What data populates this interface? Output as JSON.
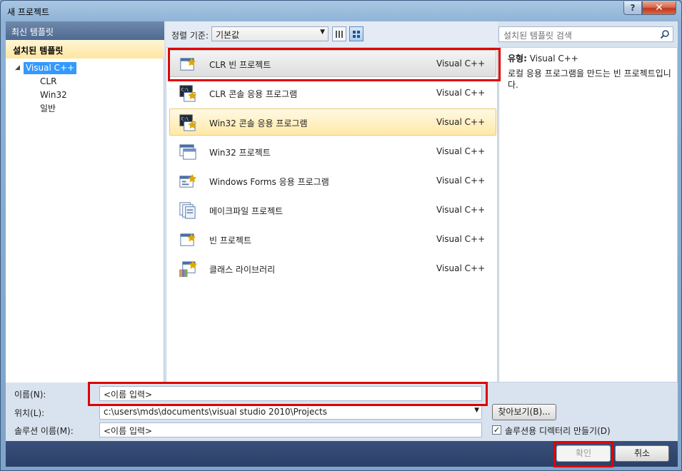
{
  "window": {
    "title": "새 프로젝트",
    "help_glyph": "?",
    "close_glyph": "✕"
  },
  "sidebar": {
    "recent_label": "최신 템플릿",
    "installed_label": "설치된 템플릿",
    "tree": {
      "root": "Visual C++",
      "children": [
        "CLR",
        "Win32",
        "일반"
      ]
    }
  },
  "toolbar": {
    "sort_label": "정렬 기준:",
    "sort_value": "기본값"
  },
  "search": {
    "placeholder": "설치된 템플릿 검색"
  },
  "templates": [
    {
      "name": "CLR 빈 프로젝트",
      "lang": "Visual C++",
      "icon": "empty-project-icon",
      "state": "selected"
    },
    {
      "name": "CLR 콘솔 응용 프로그램",
      "lang": "Visual C++",
      "icon": "console-app-icon",
      "state": ""
    },
    {
      "name": "Win32 콘솔 응용 프로그램",
      "lang": "Visual C++",
      "icon": "console-app-icon",
      "state": "hover"
    },
    {
      "name": "Win32 프로젝트",
      "lang": "Visual C++",
      "icon": "window-project-icon",
      "state": ""
    },
    {
      "name": "Windows Forms 응용 프로그램",
      "lang": "Visual C++",
      "icon": "forms-app-icon",
      "state": ""
    },
    {
      "name": "메이크파일 프로젝트",
      "lang": "Visual C++",
      "icon": "makefile-icon",
      "state": ""
    },
    {
      "name": "빈 프로젝트",
      "lang": "Visual C++",
      "icon": "empty-project-icon",
      "state": ""
    },
    {
      "name": "클래스 라이브러리",
      "lang": "Visual C++",
      "icon": "class-library-icon",
      "state": ""
    }
  ],
  "description": {
    "type_label": "유형:",
    "type_value": "Visual C++",
    "text": "로컬 응용 프로그램을 만드는 빈 프로젝트입니다."
  },
  "form": {
    "name_label": "이름(N):",
    "name_value": "<이름 입력>",
    "location_label": "위치(L):",
    "location_value": "c:\\users\\mds\\documents\\visual studio 2010\\Projects",
    "solution_label": "솔루션 이름(M):",
    "solution_value": "<이름 입력>",
    "browse_label": "찾아보기(B)...",
    "create_dir_label": "솔루션용 디렉터리 만들기(D)",
    "create_dir_checked": true
  },
  "buttons": {
    "ok_label": "확인",
    "cancel_label": "취소"
  },
  "colors": {
    "highlight": "#e00000",
    "selection": "#3399ff"
  }
}
